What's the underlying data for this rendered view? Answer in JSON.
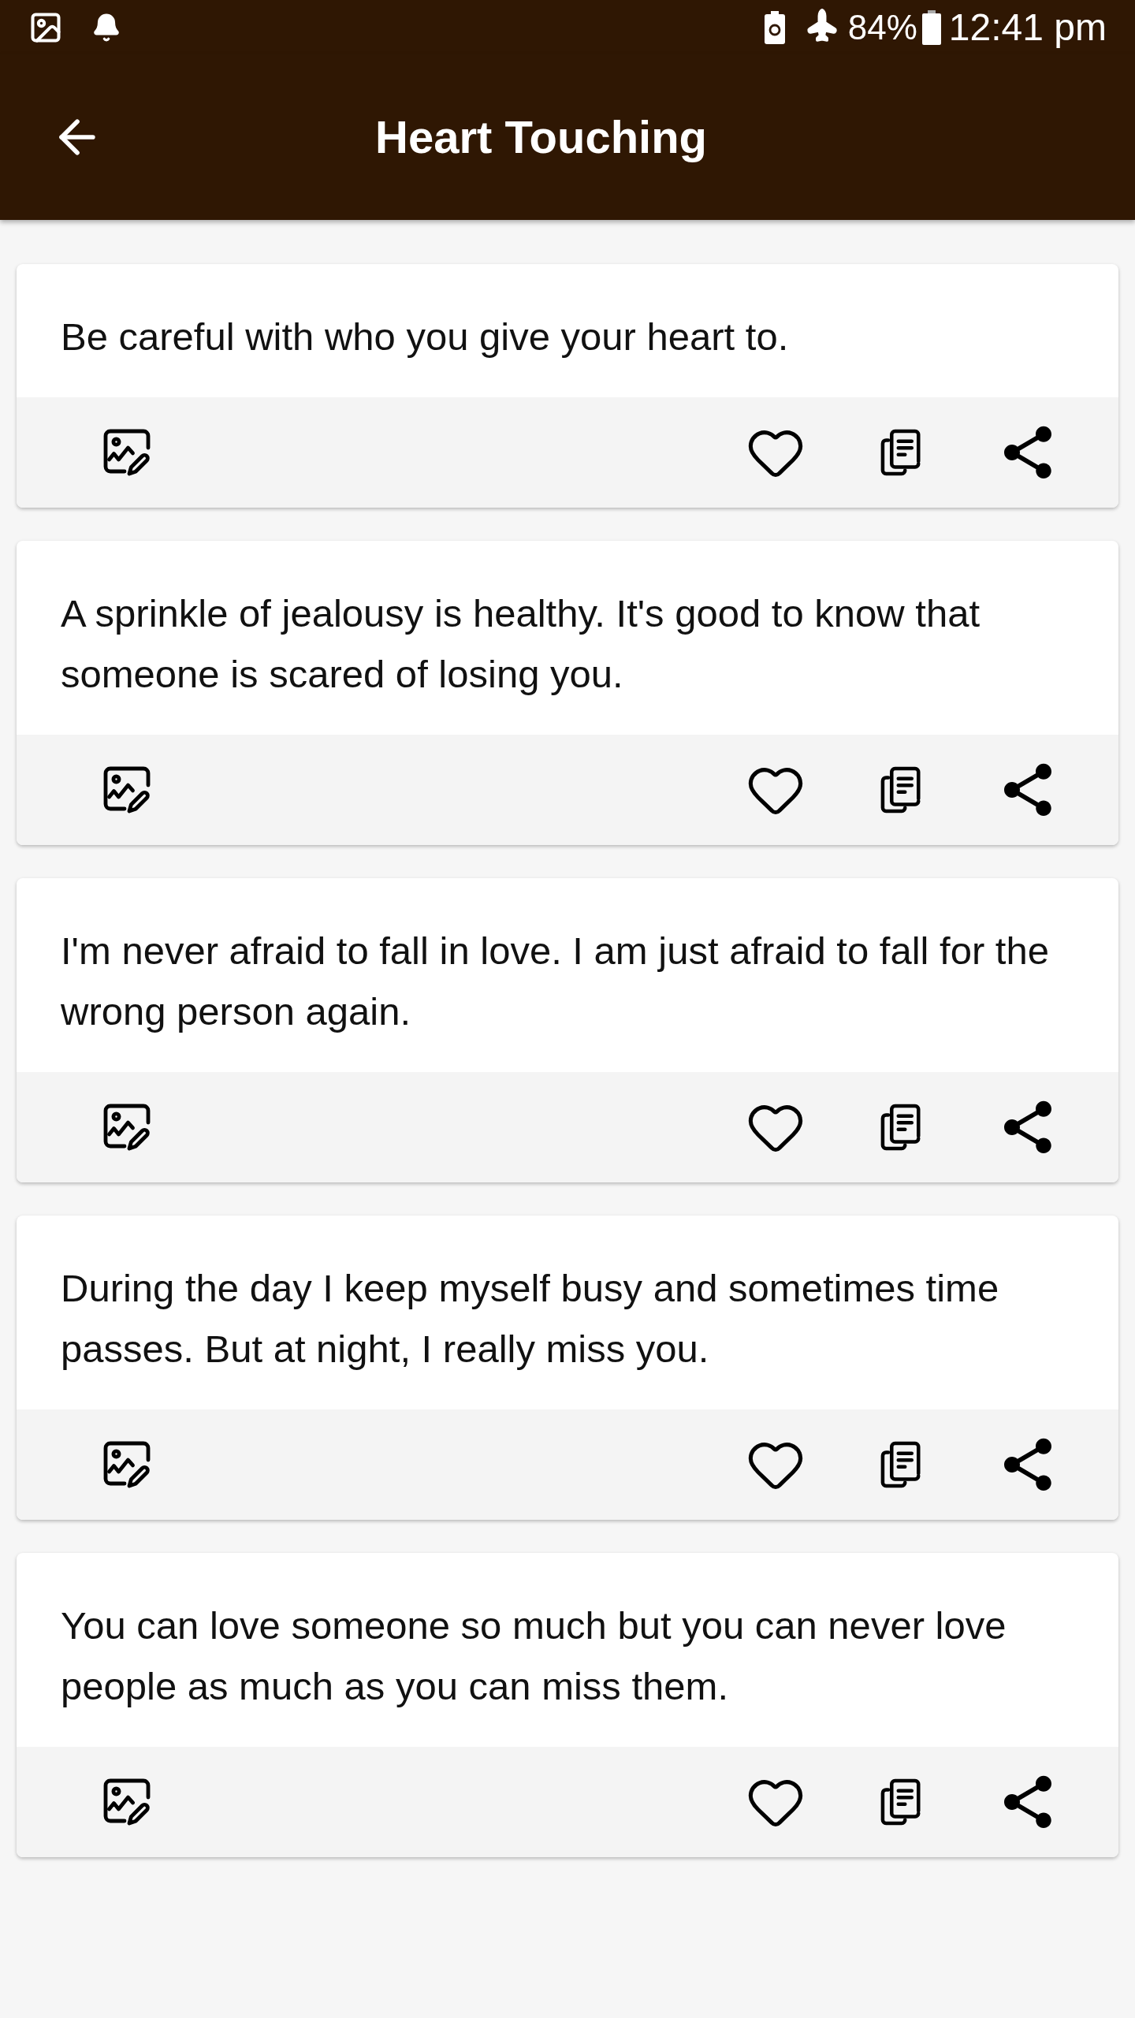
{
  "status_bar": {
    "battery": "84%",
    "time": "12:41 pm"
  },
  "header": {
    "title": "Heart Touching"
  },
  "quotes": [
    {
      "text": "Be careful with who you give your heart to."
    },
    {
      "text": "A sprinkle of jealousy is healthy. It's good to know that someone is scared of losing you."
    },
    {
      "text": "I'm never afraid to fall in love. I am just afraid to fall for the wrong person again."
    },
    {
      "text": "During the day I keep myself busy and sometimes time passes. But at night, I really miss you."
    },
    {
      "text": "You can love someone so much but you can never love people as much as you can miss them."
    }
  ]
}
